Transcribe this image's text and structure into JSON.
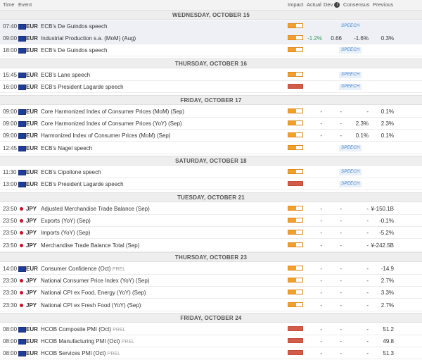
{
  "header": {
    "time": "Time",
    "event": "Event",
    "impact": "Impact",
    "actual": "Actual",
    "dev": "Dev",
    "dev_info_icon": "i",
    "consensus": "Consensus",
    "previous": "Previous"
  },
  "days": [
    {
      "label": "WEDNESDAY, OCTOBER 15"
    },
    {
      "label": "THURSDAY, OCTOBER 16"
    },
    {
      "label": "FRIDAY, OCTOBER 17"
    },
    {
      "label": "SATURDAY, OCTOBER 18"
    },
    {
      "label": "TUESDAY, OCTOBER 21"
    },
    {
      "label": "THURSDAY, OCTOBER 23"
    },
    {
      "label": "FRIDAY, OCTOBER 24"
    }
  ],
  "rows": [
    {
      "time": "07:40",
      "currency": "EUR",
      "event": "ECB's De Guindos speech",
      "prel": "",
      "impact": "medium",
      "actual": "",
      "dev": "",
      "consensus": "",
      "previous": "",
      "speech": "SPEECH"
    },
    {
      "time": "09:00",
      "currency": "EUR",
      "event": "Industrial Production s.a. (MoM) (Aug)",
      "prel": "",
      "impact": "medium",
      "actual": "-1.2%",
      "dev": "0.66",
      "consensus": "-1.6%",
      "previous": "0.3%",
      "speech": ""
    },
    {
      "time": "18:00",
      "currency": "EUR",
      "event": "ECB's De Guindos speech",
      "prel": "",
      "impact": "medium",
      "actual": "",
      "dev": "",
      "consensus": "",
      "previous": "",
      "speech": "SPEECH"
    },
    {
      "time": "15:45",
      "currency": "EUR",
      "event": "ECB's Lane speech",
      "prel": "",
      "impact": "medium",
      "actual": "",
      "dev": "",
      "consensus": "",
      "previous": "",
      "speech": "SPEECH"
    },
    {
      "time": "16:00",
      "currency": "EUR",
      "event": "ECB's President Lagarde speech",
      "prel": "",
      "impact": "high",
      "actual": "",
      "dev": "",
      "consensus": "",
      "previous": "",
      "speech": "SPEECH"
    },
    {
      "time": "09:00",
      "currency": "EUR",
      "event": "Core Harmonized Index of Consumer Prices (MoM) (Sep)",
      "prel": "",
      "impact": "medium",
      "actual": "-",
      "dev": "-",
      "consensus": "-",
      "previous": "0.1%",
      "speech": ""
    },
    {
      "time": "09:00",
      "currency": "EUR",
      "event": "Core Harmonized Index of Consumer Prices (YoY) (Sep)",
      "prel": "",
      "impact": "medium",
      "actual": "-",
      "dev": "-",
      "consensus": "2.3%",
      "previous": "2.3%",
      "speech": ""
    },
    {
      "time": "09:00",
      "currency": "EUR",
      "event": "Harmonized Index of Consumer Prices (MoM) (Sep)",
      "prel": "",
      "impact": "medium",
      "actual": "-",
      "dev": "-",
      "consensus": "0.1%",
      "previous": "0.1%",
      "speech": ""
    },
    {
      "time": "12:45",
      "currency": "EUR",
      "event": "ECB's Nagel speech",
      "prel": "",
      "impact": "medium",
      "actual": "",
      "dev": "",
      "consensus": "",
      "previous": "",
      "speech": "SPEECH"
    },
    {
      "time": "11:30",
      "currency": "EUR",
      "event": "ECB's Cipollone speech",
      "prel": "",
      "impact": "medium",
      "actual": "",
      "dev": "",
      "consensus": "",
      "previous": "",
      "speech": "SPEECH"
    },
    {
      "time": "13:00",
      "currency": "EUR",
      "event": "ECB's President Lagarde speech",
      "prel": "",
      "impact": "high",
      "actual": "",
      "dev": "",
      "consensus": "",
      "previous": "",
      "speech": "SPEECH"
    },
    {
      "time": "23:50",
      "currency": "JPY",
      "event": "Adjusted Merchandise Trade Balance (Sep)",
      "prel": "",
      "impact": "medium",
      "actual": "-",
      "dev": "-",
      "consensus": "-",
      "previous": "¥-150.1B",
      "speech": ""
    },
    {
      "time": "23:50",
      "currency": "JPY",
      "event": "Exports (YoY) (Sep)",
      "prel": "",
      "impact": "medium",
      "actual": "-",
      "dev": "-",
      "consensus": "-",
      "previous": "-0.1%",
      "speech": ""
    },
    {
      "time": "23:50",
      "currency": "JPY",
      "event": "Imports (YoY) (Sep)",
      "prel": "",
      "impact": "medium",
      "actual": "-",
      "dev": "-",
      "consensus": "-",
      "previous": "-5.2%",
      "speech": ""
    },
    {
      "time": "23:50",
      "currency": "JPY",
      "event": "Merchandise Trade Balance Total (Sep)",
      "prel": "",
      "impact": "medium",
      "actual": "-",
      "dev": "-",
      "consensus": "-",
      "previous": "¥-242.5B",
      "speech": ""
    },
    {
      "time": "14:00",
      "currency": "EUR",
      "event": "Consumer Confidence (Oct)",
      "prel": "PREL",
      "impact": "medium",
      "actual": "-",
      "dev": "-",
      "consensus": "-",
      "previous": "-14.9",
      "speech": ""
    },
    {
      "time": "23:30",
      "currency": "JPY",
      "event": "National Consumer Price Index (YoY) (Sep)",
      "prel": "",
      "impact": "medium",
      "actual": "-",
      "dev": "-",
      "consensus": "-",
      "previous": "2.7%",
      "speech": ""
    },
    {
      "time": "23:30",
      "currency": "JPY",
      "event": "National CPI ex Food, Energy (YoY) (Sep)",
      "prel": "",
      "impact": "medium",
      "actual": "-",
      "dev": "-",
      "consensus": "-",
      "previous": "3.3%",
      "speech": ""
    },
    {
      "time": "23:30",
      "currency": "JPY",
      "event": "National CPI ex Fresh Food (YoY) (Sep)",
      "prel": "",
      "impact": "medium",
      "actual": "-",
      "dev": "-",
      "consensus": "-",
      "previous": "2.7%",
      "speech": ""
    },
    {
      "time": "08:00",
      "currency": "EUR",
      "event": "HCOB Composite PMI (Oct)",
      "prel": "PREL",
      "impact": "high",
      "actual": "-",
      "dev": "-",
      "consensus": "-",
      "previous": "51.2",
      "speech": ""
    },
    {
      "time": "08:00",
      "currency": "EUR",
      "event": "HCOB Manufacturing PMI (Oct)",
      "prel": "PREL",
      "impact": "high",
      "actual": "-",
      "dev": "-",
      "consensus": "-",
      "previous": "49.8",
      "speech": ""
    },
    {
      "time": "08:00",
      "currency": "EUR",
      "event": "HCOB Services PMI (Oct)",
      "prel": "PREL",
      "impact": "high",
      "actual": "-",
      "dev": "-",
      "consensus": "-",
      "previous": "51.3",
      "speech": ""
    }
  ],
  "colors": {
    "impact_medium": "#f0a02c",
    "impact_high": "#d25c4a",
    "positive": "#2e9e57",
    "speech_text": "#3a79c9",
    "eur_flag": "#1f3c9b",
    "jpy_dot": "#c8102e"
  }
}
